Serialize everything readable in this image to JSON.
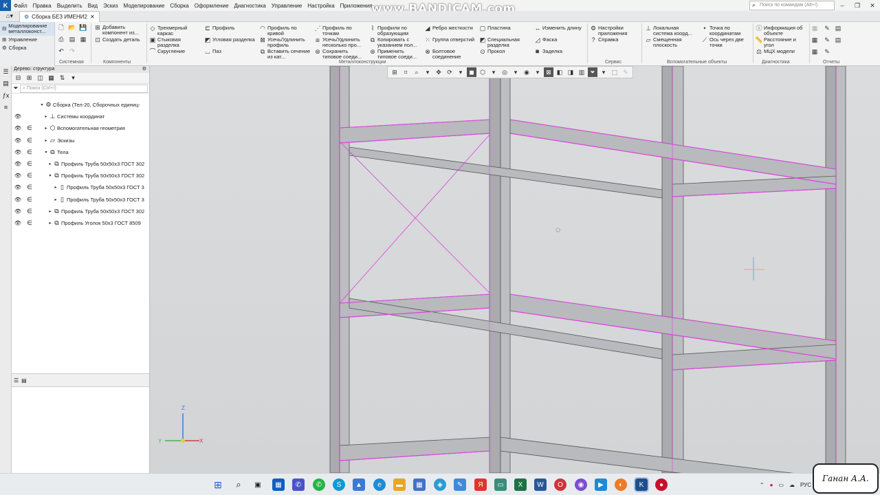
{
  "menu": [
    "Файл",
    "Правка",
    "Выделить",
    "Вид",
    "Эскиз",
    "Моделирование",
    "Сборка",
    "Оформление",
    "Диагностика",
    "Управление",
    "Настройка",
    "Приложения"
  ],
  "watermark": "www.BANDICAM.com",
  "command_search_placeholder": "Поиск по командам (Alt+/)",
  "document_tab": "Сборка БЕЗ ИМЕНИ2",
  "modes": [
    "Моделирование металлоконст...",
    "Управление",
    "Сборка"
  ],
  "ribbon": {
    "system": [
      "",
      "",
      ""
    ],
    "components": [
      "Добавить компонент из...",
      "Создать деталь"
    ],
    "metal": [
      "Трехмерный каркас",
      "Стыковая разделка",
      "Скругление",
      "Профиль",
      "Угловая разделка",
      "Паз",
      "Профиль по кривой",
      "Усечь/Удлинить профиль",
      "Вставить сечение из кат...",
      "Профиль по точкам",
      "Усечь/Удлинить несколько про...",
      "Сохранить типовое соеди...",
      "Профили по образующим",
      "Копировать с указанием пол...",
      "Применить типовое соеди...",
      "Ребро жесткости",
      "Группа отверстий",
      "Болтовое соединение",
      "Пластина",
      "Специальная разделка",
      "Прокол",
      "Изменить длину",
      "Фаска",
      "Заделка"
    ],
    "service": [
      "Настройки приложения",
      "Справка"
    ],
    "aux": [
      "Локальная система коорд...",
      "Смещенная плоскость",
      "Точка по координатам",
      "Ось через две точки"
    ],
    "diag": [
      "Информация об объекте",
      "Расстояние и угол",
      "МЦХ модели"
    ],
    "groups": [
      "Системная",
      "Компоненты",
      "Металлоконструкции",
      "Сервис",
      "Вспомогательные объекты",
      "Диагностика",
      "Отчеты"
    ]
  },
  "tree": {
    "title": "Дерево: структура",
    "search_placeholder": "Поиск (Ctrl+/)",
    "rows": [
      {
        "label": "Сборка (Тел-20, Сборочных единиц-"
      },
      {
        "label": "Системы координат"
      },
      {
        "label": "Вспомогательная геометрия"
      },
      {
        "label": "Эскизы"
      },
      {
        "label": "Тела"
      },
      {
        "label": "Профиль Труба  50x50x3 ГОСТ 302"
      },
      {
        "label": "Профиль Труба  50x50x3 ГОСТ 302"
      },
      {
        "label": "Профиль Труба  50x50x3 ГОСТ 3"
      },
      {
        "label": "Профиль Труба  50x50x3 ГОСТ 3"
      },
      {
        "label": "Профиль Труба  50x50x3 ГОСТ 302"
      },
      {
        "label": "Профиль Уголок  50x3 ГОСТ 8509"
      }
    ]
  },
  "axis": {
    "z": "Z",
    "x": "X",
    "y": "Y"
  },
  "tray": {
    "lang": "РУС"
  },
  "signature": "Ганан А.А."
}
